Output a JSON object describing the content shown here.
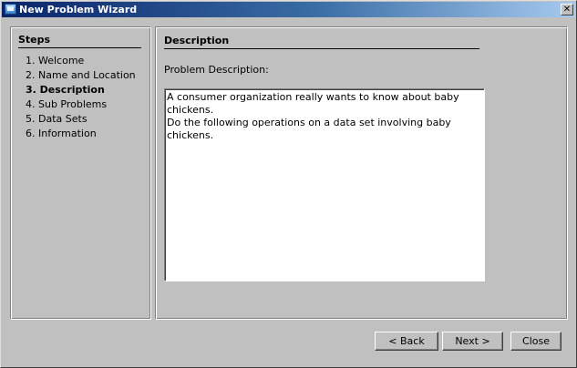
{
  "window": {
    "title": "New Problem Wizard",
    "close_glyph": "✕"
  },
  "steps": {
    "title": "Steps",
    "items": [
      {
        "label": "1. Welcome"
      },
      {
        "label": "2. Name and Location"
      },
      {
        "label": "3. Description",
        "active": true
      },
      {
        "label": "4. Sub Problems"
      },
      {
        "label": "5. Data Sets"
      },
      {
        "label": "6. Information"
      }
    ]
  },
  "content": {
    "title": "Description",
    "field_label": "Problem Description:",
    "description_value": "A consumer organization really wants to know about baby chickens.\nDo the following operations on a data set involving baby chickens."
  },
  "buttons": {
    "back": "< Back",
    "next": "Next >",
    "close": "Close"
  }
}
